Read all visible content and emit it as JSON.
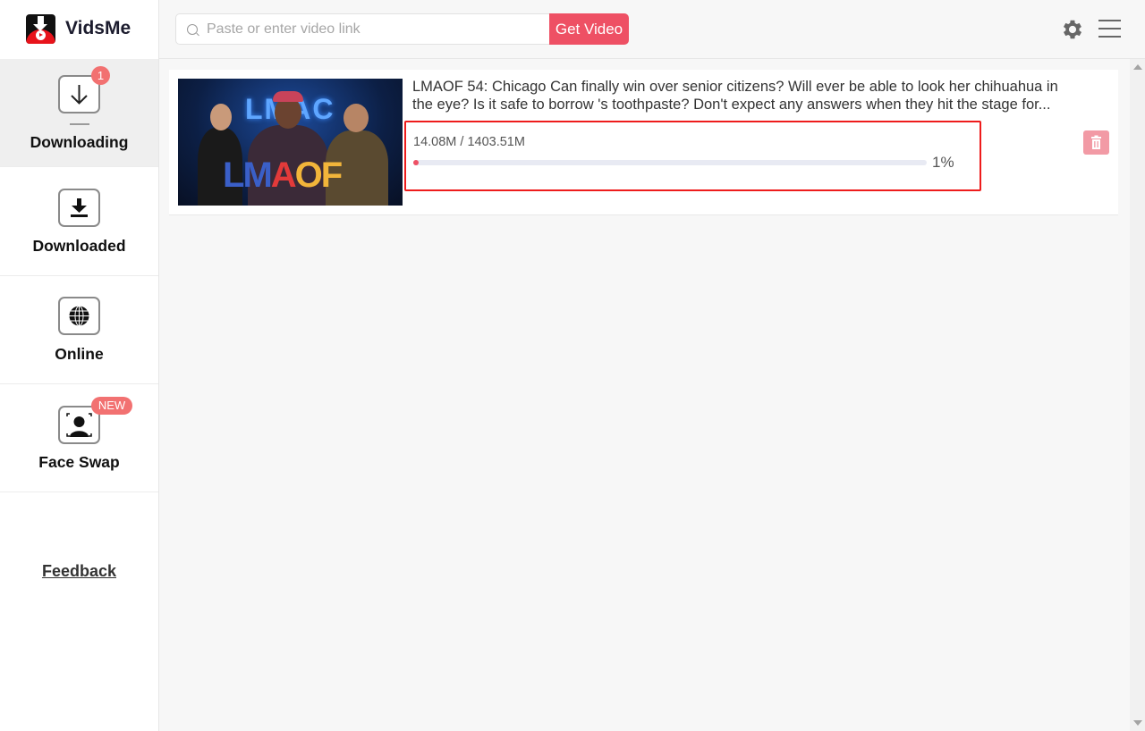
{
  "app": {
    "name": "VidsMe"
  },
  "header": {
    "search_placeholder": "Paste or enter video link",
    "search_value": "",
    "get_video_label": "Get Video",
    "icons": [
      "gear-icon",
      "menu-icon"
    ]
  },
  "sidebar": {
    "items": [
      {
        "label": "Downloading",
        "icon": "download-arrow-icon",
        "badge": "1",
        "active": true
      },
      {
        "label": "Downloaded",
        "icon": "download-tray-icon",
        "active": false
      },
      {
        "label": "Online",
        "icon": "globe-icon",
        "active": false
      },
      {
        "label": "Face Swap",
        "icon": "face-scan-icon",
        "badge": "NEW",
        "active": false
      }
    ],
    "feedback_label": "Feedback"
  },
  "downloads": [
    {
      "title": "LMAOF 54: Chicago Can finally win over senior citizens? Will ever be able to look her chihuahua in the eye? Is it safe to borrow 's toothpaste? Don't expect any answers when they hit the stage for...",
      "thumbnail_text": "LMAOF",
      "size_text": "14.08M / 1403.51M",
      "downloaded_mb": 14.08,
      "total_mb": 1403.51,
      "progress_percent": 1,
      "progress_label": "1%"
    }
  ],
  "colors": {
    "accent": "#ee5064",
    "badge": "#f27171",
    "highlight_border": "#ee1c1c",
    "trash": "#f29aa5"
  }
}
